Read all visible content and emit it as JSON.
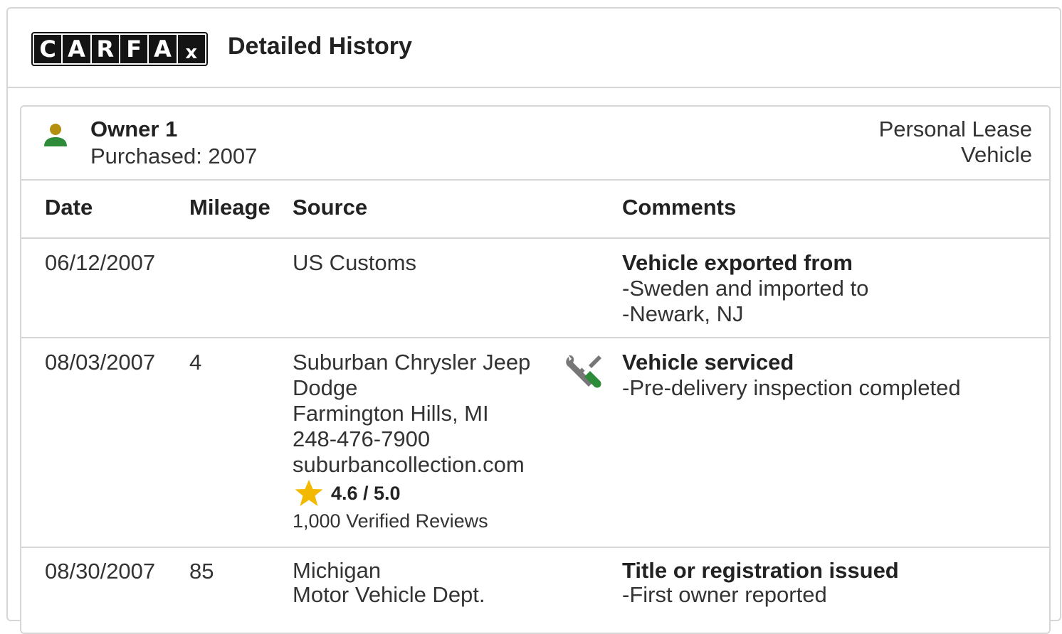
{
  "header": {
    "logo_letters": [
      "C",
      "A",
      "R",
      "F",
      "A",
      "x"
    ],
    "title": "Detailed History"
  },
  "owner": {
    "name": "Owner 1",
    "purchased": "Purchased: 2007",
    "type_line1": "Personal Lease",
    "type_line2": "Vehicle",
    "icon": "person-icon"
  },
  "columns": {
    "date": "Date",
    "mileage": "Mileage",
    "source": "Source",
    "comments": "Comments"
  },
  "rows": [
    {
      "date": "06/12/2007",
      "mileage": "",
      "source": [
        "US Customs"
      ],
      "comment_title": "Vehicle exported from",
      "comment_items": [
        "Sweden and imported to",
        "Newark, NJ"
      ]
    },
    {
      "date": "08/03/2007",
      "mileage": "4",
      "source": [
        "Suburban Chrysler Jeep",
        "Dodge",
        "Farmington Hills, MI",
        "248-476-7900",
        "suburbancollection.com"
      ],
      "rating": "4.6 / 5.0",
      "reviews": "1,000 Verified Reviews",
      "icon": "wrench-screwdriver-icon",
      "comment_title": "Vehicle serviced",
      "comment_items": [
        "Pre-delivery inspection completed"
      ]
    },
    {
      "date": "08/30/2007",
      "mileage": "85",
      "source": [
        "Michigan",
        "Motor Vehicle Dept."
      ],
      "comment_title": "Title or registration issued",
      "comment_items": [
        "First owner reported"
      ]
    }
  ],
  "colors": {
    "star": "#f2b900",
    "person_head": "#b58f10",
    "person_body": "#2e8b3a",
    "tool_green": "#2e8b3a",
    "tool_gray": "#777777"
  }
}
